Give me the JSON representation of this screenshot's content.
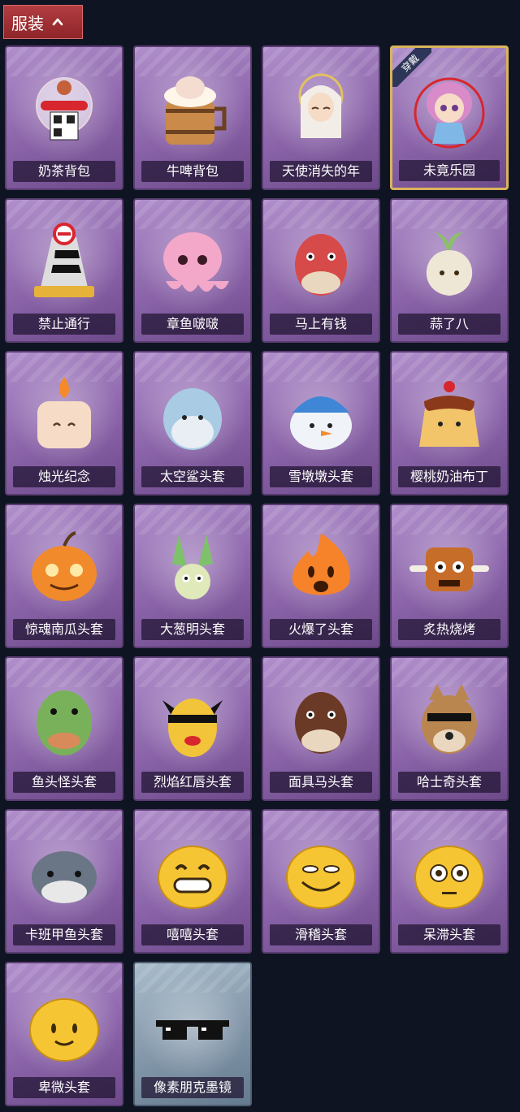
{
  "section": {
    "title": "服装"
  },
  "items": [
    {
      "name": "奶茶背包",
      "icon": "milk-tea-backpack-icon",
      "color": "#f2c2d8"
    },
    {
      "name": "牛啤背包",
      "icon": "beer-barrel-backpack-icon",
      "color": "#c98a4a"
    },
    {
      "name": "天使消失的年",
      "icon": "angel-doll-icon",
      "color": "#e8d9c8"
    },
    {
      "name": "未竟乐园",
      "icon": "pink-hair-doll-icon",
      "color": "#d98ac9",
      "badge": "穿戴"
    },
    {
      "name": "禁止通行",
      "icon": "no-entry-cone-icon",
      "color": "#e6b23a"
    },
    {
      "name": "章鱼啵啵",
      "icon": "pink-octopus-icon",
      "color": "#f3a7c9"
    },
    {
      "name": "马上有钱",
      "icon": "red-horse-head-icon",
      "color": "#d74a4a"
    },
    {
      "name": "蒜了八",
      "icon": "garlic-head-icon",
      "color": "#efe7d5"
    },
    {
      "name": "烛光纪念",
      "icon": "candle-head-icon",
      "color": "#f6dcc7"
    },
    {
      "name": "太空鲨头套",
      "icon": "space-shark-icon",
      "color": "#a9cbe4"
    },
    {
      "name": "雪墩墩头套",
      "icon": "snowman-hat-icon",
      "color": "#f0f3f8"
    },
    {
      "name": "樱桃奶油布丁",
      "icon": "pudding-icon",
      "color": "#f3c56b"
    },
    {
      "name": "惊魂南瓜头套",
      "icon": "pumpkin-icon",
      "color": "#f18a2b"
    },
    {
      "name": "大葱明头套",
      "icon": "green-onion-icon",
      "color": "#7fc16b"
    },
    {
      "name": "火爆了头套",
      "icon": "fire-face-icon",
      "color": "#f6822a"
    },
    {
      "name": "炙热烧烤",
      "icon": "bbq-meat-icon",
      "color": "#c76d2a"
    },
    {
      "name": "鱼头怪头套",
      "icon": "fish-head-icon",
      "color": "#79b15a"
    },
    {
      "name": "烈焰红唇头套",
      "icon": "yellow-pikachu-mask-icon",
      "color": "#f2c43a"
    },
    {
      "name": "面具马头套",
      "icon": "horse-mask-icon",
      "color": "#6b3a26"
    },
    {
      "name": "哈士奇头套",
      "icon": "husky-head-icon",
      "color": "#b9864f"
    },
    {
      "name": "卡班甲鱼头套",
      "icon": "gray-fish-icon",
      "color": "#6a7586"
    },
    {
      "name": "嘻嘻头套",
      "icon": "grin-emoji-icon",
      "color": "#f6c533"
    },
    {
      "name": "滑稽头套",
      "icon": "funny-emoji-icon",
      "color": "#f6c533"
    },
    {
      "name": "呆滞头套",
      "icon": "dazed-emoji-icon",
      "color": "#f6c533"
    },
    {
      "name": "卑微头套",
      "icon": "humble-emoji-icon",
      "color": "#f6c533"
    },
    {
      "name": "像素朋克墨镜",
      "icon": "pixel-sunglasses-icon",
      "color": "#111111",
      "special": true
    }
  ]
}
